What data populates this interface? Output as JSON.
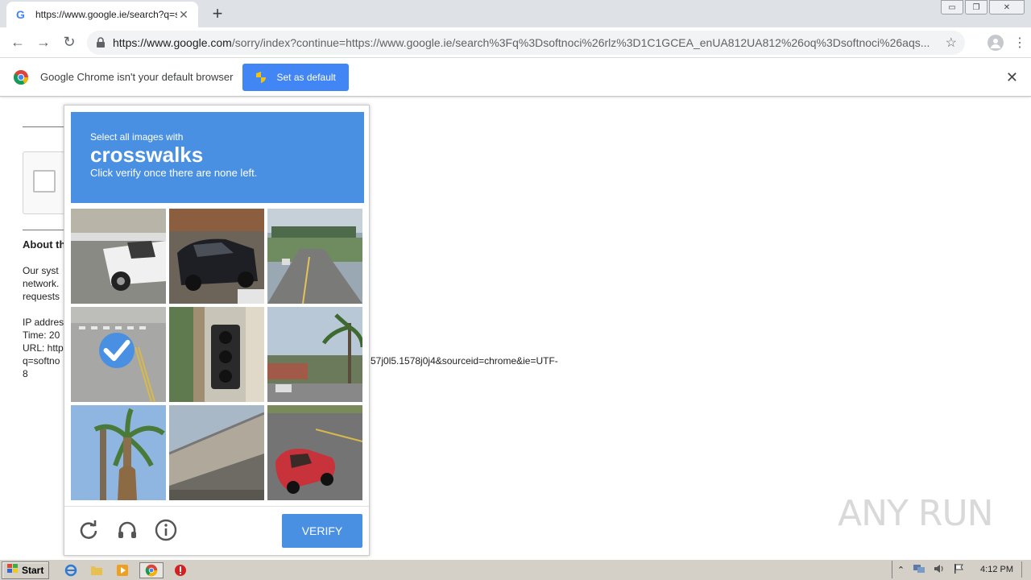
{
  "tab": {
    "title": "https://www.google.ie/search?q=so",
    "close": "✕",
    "new_tab": "+"
  },
  "window_controls": {
    "minimize": "▭",
    "restore": "❐",
    "close": "✕"
  },
  "toolbar": {
    "back": "←",
    "forward": "→",
    "reload": "↻",
    "url_host": "https://www.google.com",
    "url_rest": "/sorry/index?continue=https://www.google.ie/search%3Fq%3Dsoftnoci%26rlz%3D1C1GCEA_enUA812UA812%26oq%3Dsoftnoci%26aqs...",
    "star": "☆",
    "menu": "⋮"
  },
  "infobar": {
    "message": "Google Chrome isn't your default browser",
    "button": "Set as default",
    "close": "✕"
  },
  "page": {
    "about": "About th",
    "p1": "Our syst",
    "p2": "network.",
    "p3": "requests",
    "ip": "IP addres",
    "time": "Time: 20",
    "url_label": "URL: http",
    "q": "q=softno",
    "tail": "57j0l5.1578j0j4&sourceid=chrome&ie=UTF-",
    "eight": "8"
  },
  "captcha": {
    "select_text": "Select all images with",
    "object": "crosswalks",
    "subtitle": "Click verify once there are none left.",
    "verify": "VERIFY",
    "tiles": [
      {
        "name": "white pickup truck",
        "selected": false
      },
      {
        "name": "black suv",
        "selected": false
      },
      {
        "name": "road with bridge",
        "selected": false
      },
      {
        "name": "crosswalk",
        "selected": true
      },
      {
        "name": "traffic light",
        "selected": false
      },
      {
        "name": "palm trees street",
        "selected": false
      },
      {
        "name": "palm tree",
        "selected": false
      },
      {
        "name": "overpass",
        "selected": false
      },
      {
        "name": "red convertible",
        "selected": false
      }
    ]
  },
  "watermark": "ANY RUN",
  "taskbar": {
    "start": "Start",
    "time": "4:12 PM"
  },
  "colors": {
    "captcha_blue": "#4a90e2",
    "chrome_button_blue": "#4285f4"
  }
}
